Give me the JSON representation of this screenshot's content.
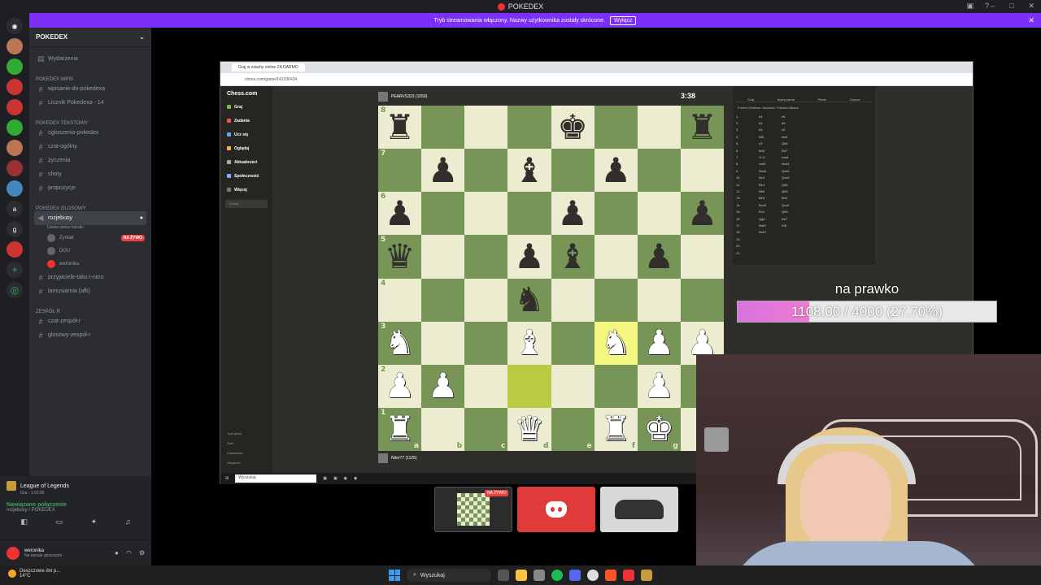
{
  "window": {
    "title": "POKEDEX"
  },
  "banner": {
    "text": "Tryb streamowania włączony. Nazwy użytkownika zostały skrócone.",
    "button": "Wyłącz"
  },
  "server": {
    "name": "POKEDEX"
  },
  "sidebar": {
    "events": "Wydarzenia",
    "cat1": "POKEDEX Wpis",
    "ch1": [
      "wpisanie-do-pokedexa",
      "Licznik Pokedexa - 14"
    ],
    "cat2": "POKEDEX Tekstowy",
    "ch2": [
      "ogloszenia-pokedex",
      "czat-ogólny",
      "życzenia",
      "shoty",
      "propozycje"
    ],
    "cat3": "POKEDEX GLOSOWY",
    "voice_active": "rozjebusy",
    "voice_active_sub": "Ustaw status kanału",
    "voice_users": [
      "Zyniak",
      "DGU",
      "weronika"
    ],
    "live_badge": "NA ŻYWO",
    "ch3": [
      "przyjaciele-taku-i-nitro",
      "lamusiarnia (afk)"
    ],
    "cat4": "Zespół R",
    "ch4": [
      "czat-zespół-r",
      "glosowy-zespół-r"
    ]
  },
  "activity": {
    "game": "League of Legends",
    "game_sub": "Gra - 1:02:00",
    "connected": "Nawiązano połączenie",
    "connected_sub": "rozjebusy / POKEDEX"
  },
  "user": {
    "name": "weronika",
    "status": "Na kanale głosowym"
  },
  "browser": {
    "tab": "Graj w szachy online ZA DARMO",
    "url": "chess.com/game/141336434"
  },
  "chesscom": {
    "logo": "Chess.com",
    "menu": [
      "Graj",
      "Zadania",
      "Ucz się",
      "Oglądaj",
      "Aktualności",
      "Społeczność",
      "Więcej"
    ],
    "search": "Szukaj",
    "footer": [
      "Tryb jasny",
      "Zwiń",
      "Ustawienia",
      "Wsparcie"
    ],
    "top_player": "PEARVS323 (1059)",
    "bottom_player": "Niter77 (1125)",
    "clock": "3:38",
    "opening": "French Defense: Advance, Paulsen Attack",
    "tabs": [
      "Graj",
      "Nowa partia",
      "Partie",
      "Gracze"
    ],
    "moves": [
      [
        "1.",
        "e4",
        "e6"
      ],
      [
        "2.",
        "d4",
        "d5"
      ],
      [
        "3.",
        "e5",
        "c5"
      ],
      [
        "4.",
        "Nf3",
        "Nc6"
      ],
      [
        "5.",
        "c3",
        "Qb6"
      ],
      [
        "6.",
        "Bd3",
        "Bd7"
      ],
      [
        "7.",
        "O-O",
        "cxd4"
      ],
      [
        "8.",
        "cxd4",
        "Nxd4"
      ],
      [
        "9.",
        "Nxd4",
        "Qxd4"
      ],
      [
        "10.",
        "Nc3",
        "Qxe5"
      ],
      [
        "11.",
        "Re1",
        "Qd6"
      ],
      [
        "12.",
        "Nb5",
        "Qb6"
      ],
      [
        "13.",
        "Be3",
        "Bc5"
      ],
      [
        "14.",
        "Bxc5",
        "Qxc5"
      ],
      [
        "15.",
        "Rc1",
        "Qb6"
      ],
      [
        "16.",
        "Qg4",
        "Ne7"
      ],
      [
        "17.",
        "Nd6+",
        "Kf8"
      ],
      [
        "18.",
        "Nxb7",
        ""
      ],
      [
        "19.",
        "",
        ""
      ],
      [
        "20.",
        "",
        ""
      ],
      [
        "21.",
        "",
        ""
      ]
    ]
  },
  "board": {
    "ranks": [
      "8",
      "7",
      "6",
      "5",
      "4",
      "3",
      "2",
      "1"
    ],
    "files": [
      "a",
      "b",
      "c",
      "d",
      "e",
      "f",
      "g",
      "h"
    ],
    "rows": [
      [
        "br",
        "",
        "",
        "",
        "bk",
        "",
        "",
        "br"
      ],
      [
        "",
        "bp",
        "",
        "bb",
        "",
        "bp",
        "",
        ""
      ],
      [
        "bp",
        "",
        "",
        "",
        "bp",
        "",
        "",
        "bp"
      ],
      [
        "bq",
        "",
        "",
        "bp",
        "bb",
        "",
        "bp",
        ""
      ],
      [
        "",
        "",
        "",
        "bn",
        "",
        "",
        "",
        ""
      ],
      [
        "wn",
        "",
        "",
        "wb",
        "",
        "wn",
        "wp",
        "wp"
      ],
      [
        "wp",
        "wp",
        "",
        "",
        "",
        "",
        "wp",
        ""
      ],
      [
        "wr",
        "",
        "",
        "wq",
        "",
        "wr",
        "wk",
        ""
      ]
    ],
    "highlight": [
      "5-5"
    ],
    "highlight2": [
      "6-3"
    ]
  },
  "goal": {
    "title": "na prawko",
    "text": "1108.00 / 4000 (27.70%)",
    "progress": 0.277
  },
  "thumbs": {
    "live": "NA ŻYWO"
  },
  "taskbar": {
    "weather": "Deszczowe dni p...",
    "temp": "14°C",
    "search": "Wyszukaj",
    "browser_search": "Wyszukaj"
  }
}
